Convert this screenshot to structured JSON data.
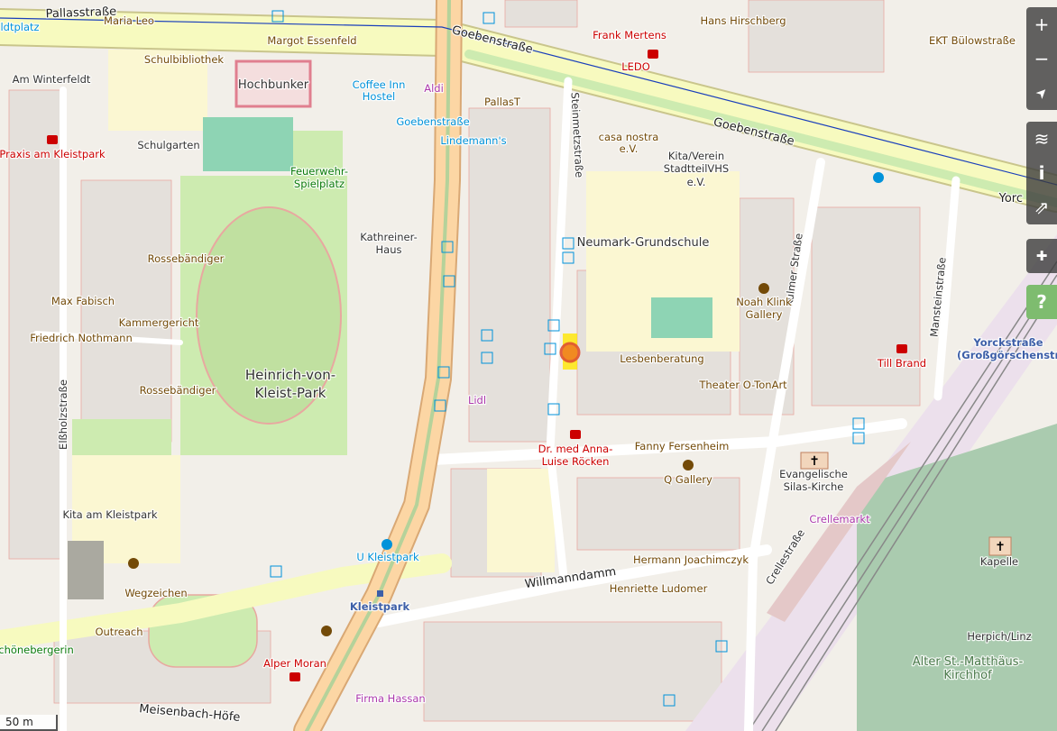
{
  "streets": {
    "pallas": "Pallasstraße",
    "goeben1": "Goebenstraße",
    "goeben2": "Goebenstraße",
    "steinmetz": "Steinmetzstraße",
    "kulmer": "Kulmer Straße",
    "manstein": "Mansteinstraße",
    "elss": "Elßholzstraße",
    "willmann": "Willmanndamm",
    "meisenbach": "Meisenbach-Höfe",
    "crelle": "Crellestraße",
    "winterfeldt": "Am Winterfeldt",
    "platz": "ldtplatz",
    "yorc": "Yorc"
  },
  "poi": {
    "maria": "Maria Leo",
    "margot": "Margot Essenfeld",
    "hans": "Hans Hirschberg",
    "frank": "Frank Mertens",
    "ledo": "LEDO",
    "ekt": "EKT Bülowstraße",
    "schulbib": "Schulbibliothek",
    "hochbunker": "Hochbunker",
    "coffee": [
      "Coffee Inn",
      "Hostel"
    ],
    "aldi": "Aldi",
    "pallast": "PallasT",
    "goebenstop": "Goebenstraße",
    "lindemann": "Lindemann's",
    "casa": [
      "casa nostra",
      "e.V."
    ],
    "kita_verein": [
      "Kita/Verein",
      "StadtteilVHS",
      "e.V."
    ],
    "praxis": "Praxis am Kleistpark",
    "schulgarten": "Schulgarten",
    "feuerwehr": [
      "Feuerwehr-",
      "Spielplatz"
    ],
    "kathreiner": [
      "Kathreiner-",
      "Haus"
    ],
    "neumark": "Neumark-Grundschule",
    "rosse1": "Rossebändiger",
    "rosse2": "Rossebändiger",
    "max": "Max Fabisch",
    "kammer": "Kammergericht",
    "friedrich": "Friedrich Nothmann",
    "park": [
      "Heinrich-von-",
      "Kleist-Park"
    ],
    "noah": [
      "Noah Klink",
      "Gallery"
    ],
    "lesben": "Lesbenberatung",
    "till": "Till Brand",
    "yorck": [
      "Yorckstraße",
      "(Großgörschenstra"
    ],
    "theater": "Theater O-TonArt",
    "lidl": "Lidl",
    "anna": [
      "Dr. med Anna-",
      "Luise Röcken"
    ],
    "fanny": "Fanny Fersenheim",
    "silas": [
      "Evangelische",
      "Silas-Kirche"
    ],
    "qgallery": "Q Gallery",
    "crellemarkt": "Crellemarkt",
    "kita": "Kita am Kleistpark",
    "ukleist": "U Kleistpark",
    "hermann": "Hermann Joachimczyk",
    "henriette": "Henriette Ludomer",
    "kapelle": "Kapelle",
    "wegzeichen": "Wegzeichen",
    "kleistpark": "Kleistpark",
    "herpich": "Herpich/Linz",
    "matthaeus": [
      "Alter St.-Matthäus-",
      "Kirchhof"
    ],
    "outreach": "Outreach",
    "schoeneberg": "chönebergerin",
    "alper": "Alper Moran",
    "hassan": "Firma Hassan"
  },
  "controls": {
    "zoom_in": "+",
    "zoom_out": "−",
    "locate": "➤",
    "layers": "≋",
    "info": "i",
    "share": "⇗",
    "note": "✚",
    "query": "?"
  },
  "scale": "50 m",
  "colors": {
    "primary_road": "#fcd6a4",
    "secondary_road": "#f7fabf",
    "park": "#cdebb0",
    "marker": "#f08020"
  }
}
